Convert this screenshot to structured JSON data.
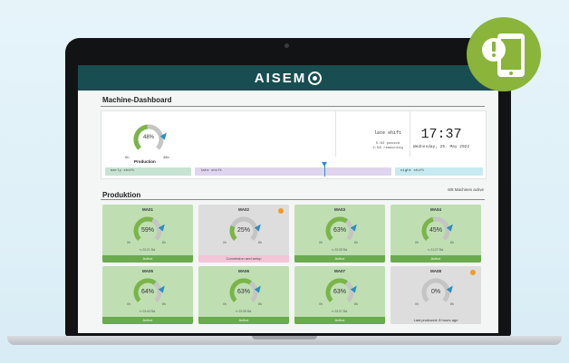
{
  "brand": {
    "logo_text": "AISEM",
    "accent": "#184e52"
  },
  "dashboard": {
    "title": "Machine-Dashboard",
    "overall_gauge": {
      "percent": "48%",
      "label": "Production",
      "min": "0h",
      "max": "48h",
      "fraction": 0.48
    },
    "shift": {
      "name": "late shift",
      "passed": "5:02 passed",
      "remaining": "2:58 remaining"
    },
    "clock": {
      "time": "17:37",
      "date": "Wednesday, 25. May 2022"
    },
    "timeline": {
      "early": "early shift",
      "late": "late shift",
      "night": "night shift"
    }
  },
  "production": {
    "title": "Produktion",
    "count": "6/8 Machines active"
  },
  "machines": [
    {
      "name": "MA01",
      "percent": "59%",
      "fraction": 0.59,
      "duration": "03:21 Std.",
      "status": "Active",
      "state": "active"
    },
    {
      "name": "MA02",
      "percent": "25%",
      "fraction": 0.25,
      "duration": "",
      "status": "Conversion and setup",
      "state": "setup"
    },
    {
      "name": "MA03",
      "percent": "63%",
      "fraction": 0.63,
      "duration": "03:35 Std.",
      "status": "Active",
      "state": "active"
    },
    {
      "name": "MA04",
      "percent": "45%",
      "fraction": 0.45,
      "duration": "01:27 Std.",
      "status": "Active",
      "state": "active"
    },
    {
      "name": "MA05",
      "percent": "64%",
      "fraction": 0.64,
      "duration": "03:40 Std.",
      "status": "Active",
      "state": "active"
    },
    {
      "name": "MA06",
      "percent": "63%",
      "fraction": 0.63,
      "duration": "03:35 Std.",
      "status": "Active",
      "state": "active"
    },
    {
      "name": "MA07",
      "percent": "63%",
      "fraction": 0.63,
      "duration": "03:37 Std.",
      "status": "Active",
      "state": "active"
    },
    {
      "name": "MA08",
      "percent": "0%",
      "fraction": 0.0,
      "duration": "",
      "status": "Last produced: 8 hours ago",
      "state": "idle"
    }
  ],
  "axis": {
    "min": "0h",
    "max": "8h"
  },
  "colors": {
    "green": "#7bb548",
    "grey": "#c4c4c4",
    "pointer": "#2a8fc4",
    "alert": "#f39a25",
    "badge": "#8ab43a"
  },
  "badge_icon": "phone-alert-icon"
}
